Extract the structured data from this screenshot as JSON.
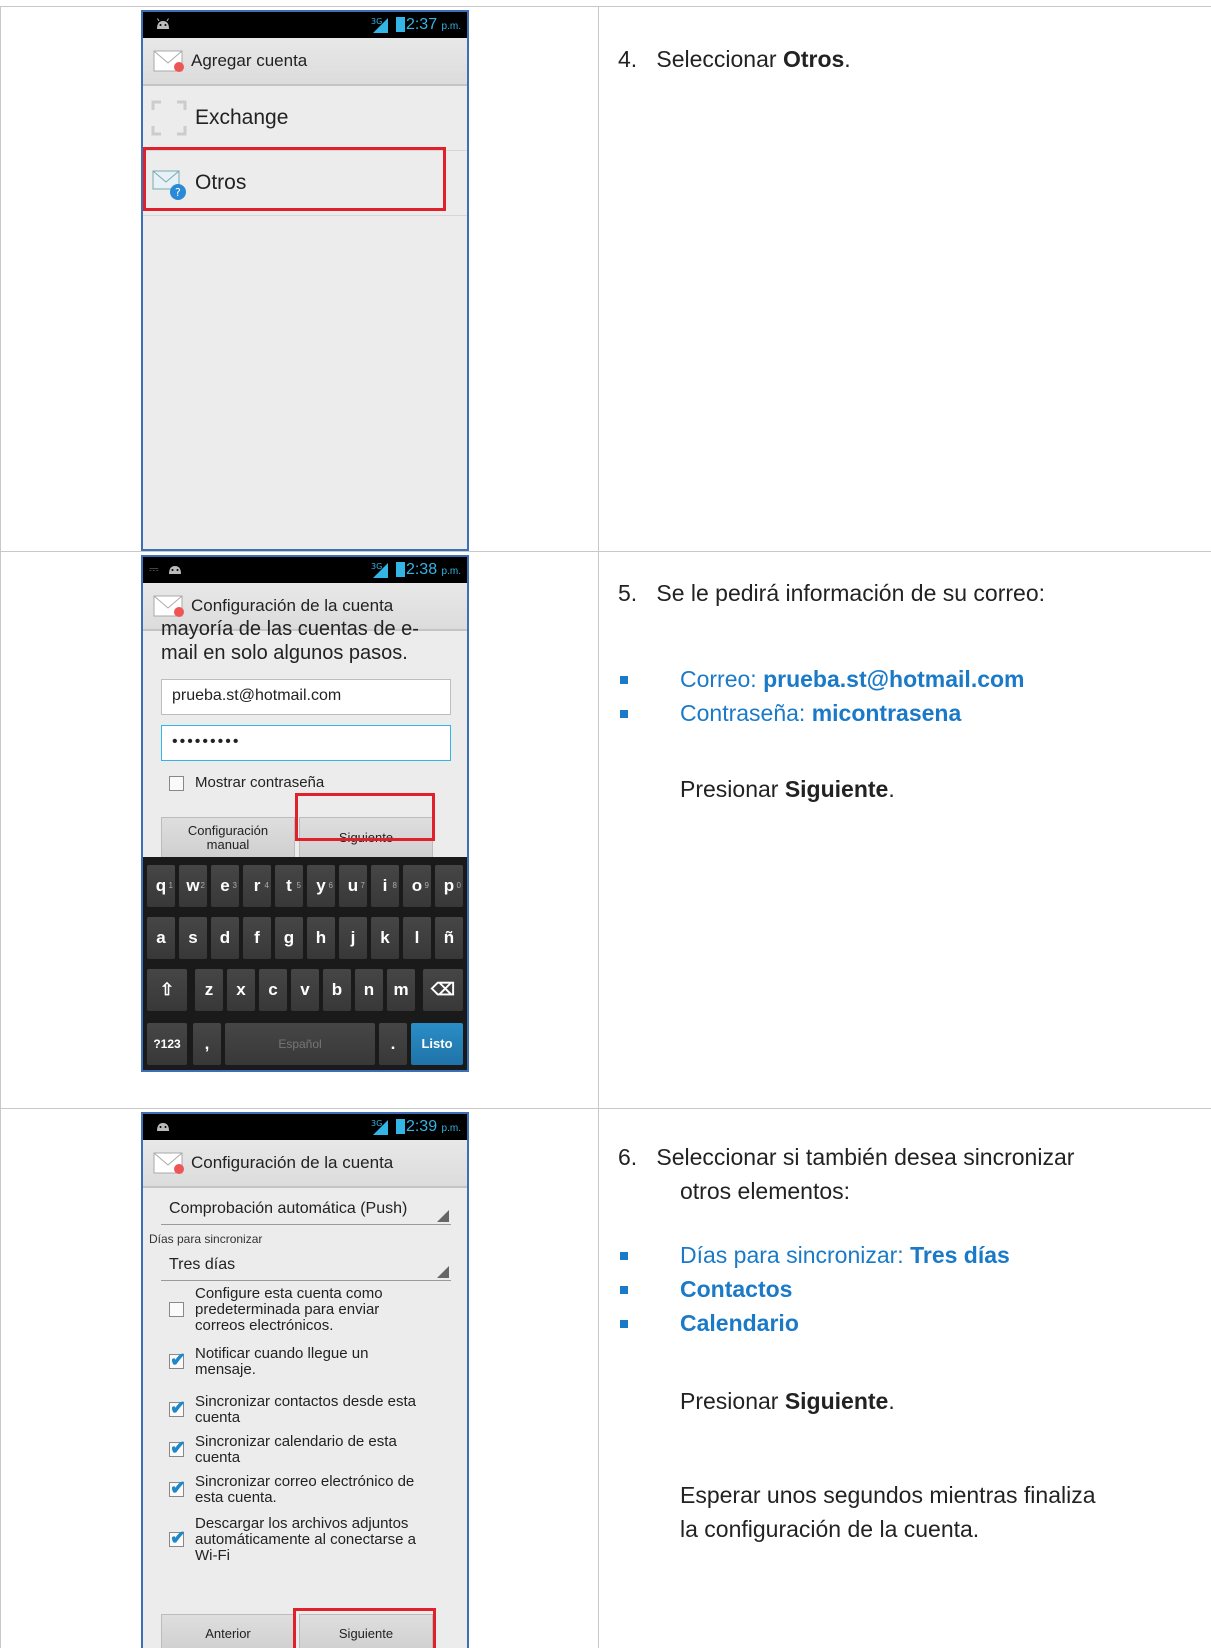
{
  "phone1": {
    "status_time": "2:37",
    "status_suffix": "p.m.",
    "title": "Agregar cuenta",
    "items": [
      "Exchange",
      "Otros"
    ]
  },
  "phone2": {
    "status_time": "2:38",
    "status_suffix": "p.m.",
    "title": "Configuración de la cuenta",
    "intro_line1": "mayoría de las cuentas de e-",
    "intro_line2": "mail en solo algunos pasos.",
    "email_value": "prueba.st@hotmail.com",
    "password_value": "•••••••••",
    "show_password": "Mostrar contraseña",
    "manual_btn_line1": "Configuración",
    "manual_btn_line2": "manual",
    "next_btn": "Siguiente",
    "keyboard": {
      "row1": [
        "q",
        "w",
        "e",
        "r",
        "t",
        "y",
        "u",
        "i",
        "o",
        "p"
      ],
      "row1_nums": [
        "1",
        "2",
        "3",
        "4",
        "5",
        "6",
        "7",
        "8",
        "9",
        "0"
      ],
      "row2": [
        "a",
        "s",
        "d",
        "f",
        "g",
        "h",
        "j",
        "k",
        "l",
        "ñ"
      ],
      "row3": [
        "z",
        "x",
        "c",
        "v",
        "b",
        "n",
        "m"
      ],
      "sym": "?123",
      "comma": ",",
      "space": "Español",
      "period": ".",
      "done": "Listo"
    }
  },
  "phone3": {
    "status_time": "2:39",
    "status_suffix": "p.m.",
    "title": "Configuración de la cuenta",
    "check_frequency": "Comprobación automática (Push)",
    "sync_days_label": "Días para sincronizar",
    "sync_days_value": "Tres días",
    "options": [
      {
        "text": [
          "Configure esta cuenta como",
          "predeterminada para enviar",
          "correos electrónicos."
        ],
        "checked": false
      },
      {
        "text": [
          "Notificar cuando llegue un",
          "mensaje."
        ],
        "checked": true
      },
      {
        "text": [
          "Sincronizar contactos desde esta",
          "cuenta"
        ],
        "checked": true
      },
      {
        "text": [
          "Sincronizar calendario de esta",
          "cuenta"
        ],
        "checked": true
      },
      {
        "text": [
          "Sincronizar correo electrónico de",
          "esta cuenta."
        ],
        "checked": true
      },
      {
        "text": [
          "Descargar los archivos adjuntos",
          "automáticamente al conectarse a",
          "Wi-Fi"
        ],
        "checked": true
      }
    ],
    "prev_btn": "Anterior",
    "next_btn": "Siguiente"
  },
  "step4": {
    "number": "4.",
    "text": "Seleccionar ",
    "bold": "Otros",
    "end": "."
  },
  "step5": {
    "number": "5.",
    "text": "Se le pedirá información de su correo:",
    "bullet1_label": "Correo: ",
    "bullet1_value": "prueba.st@hotmail.com",
    "bullet2_label": "Contraseña: ",
    "bullet2_value": "micontrasena",
    "press": "Presionar ",
    "press_bold": "Siguiente",
    "press_end": "."
  },
  "step6": {
    "number": "6.",
    "text_line1": "Seleccionar si también desea sincronizar",
    "text_line2": "otros elementos:",
    "bullet1_label": "Días para sincronizar: ",
    "bullet1_value": "Tres días",
    "bullet2": "Contactos",
    "bullet3": "Calendario",
    "press": "Presionar ",
    "press_bold": "Siguiente",
    "press_end": ".",
    "wait_line1": "Esperar unos segundos mientras finaliza",
    "wait_line2": "la configuración de la cuenta."
  },
  "colors": {
    "accent_blue": "#1a7ac8",
    "highlight_red": "#e0202a",
    "holo_blue": "#33b5e5"
  }
}
